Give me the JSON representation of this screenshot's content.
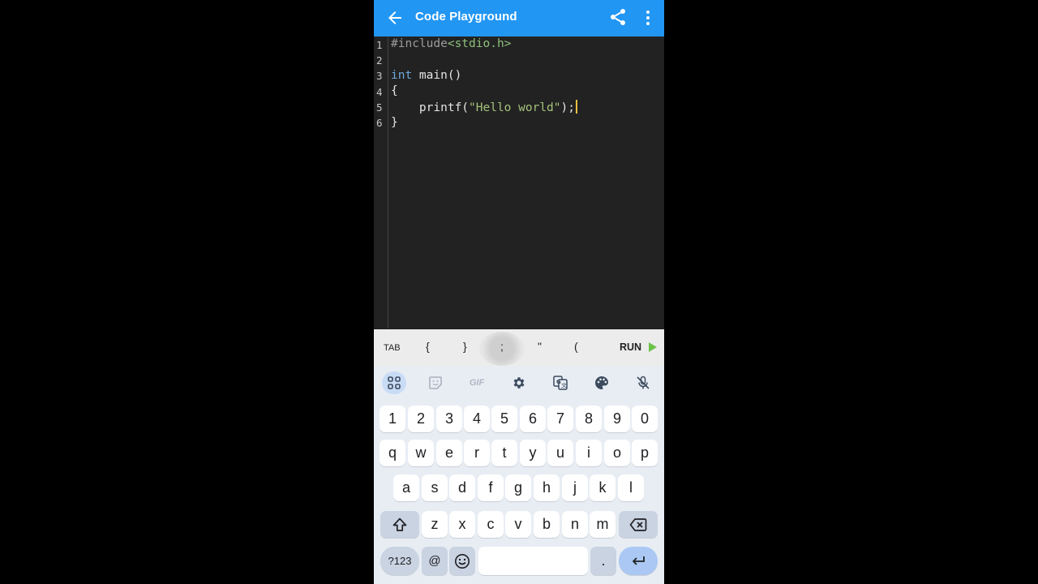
{
  "app": {
    "title": "Code Playground",
    "accent_color": "#2196f3",
    "icons": [
      "back-arrow-icon",
      "share-icon",
      "more-vert-icon"
    ]
  },
  "editor": {
    "line_numbers": [
      "1",
      "2",
      "3",
      "4",
      "5",
      "6"
    ],
    "lines": {
      "l1_pre": "#include",
      "l1_inc": "<stdio.h>",
      "l3_kw": "int",
      "l3_rest": " main()",
      "l4": "{",
      "l5_fn": "    printf(",
      "l5_str": "\"Hello world\"",
      "l5_end": ");",
      "l6": "}"
    }
  },
  "symbol_bar": {
    "tab": "TAB",
    "brace_open": "{",
    "brace_close": "}",
    "semicolon": ";",
    "quote": "\"",
    "paren_open": "(",
    "run": "RUN"
  },
  "keyboard": {
    "toolbar_icons": [
      "apps-grid-icon",
      "sticker-icon",
      "gif-icon",
      "settings-icon",
      "translate-icon",
      "palette-icon",
      "mic-off-icon"
    ],
    "gif_label": "GIF",
    "row_numbers": [
      "1",
      "2",
      "3",
      "4",
      "5",
      "6",
      "7",
      "8",
      "9",
      "0"
    ],
    "row_top": [
      "q",
      "w",
      "e",
      "r",
      "t",
      "y",
      "u",
      "i",
      "o",
      "p"
    ],
    "row_middle": [
      "a",
      "s",
      "d",
      "f",
      "g",
      "h",
      "j",
      "k",
      "l"
    ],
    "row_bottom": [
      "z",
      "x",
      "c",
      "v",
      "b",
      "n",
      "m"
    ],
    "sym_key": "?123",
    "at_key": "@",
    "period_key": "."
  }
}
